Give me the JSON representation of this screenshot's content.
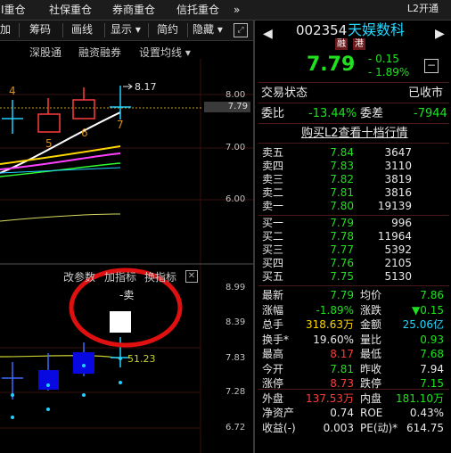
{
  "top_tabs": [
    "I重仓",
    "社保重仓",
    "券商重仓",
    "信托重仓",
    "»"
  ],
  "l2_label": "L2开通",
  "toolbar": [
    "加",
    "筹码",
    "画线",
    "显示 ▾",
    "简约",
    "隐藏 ▾"
  ],
  "subtoolbar": [
    "深股通",
    "融资融券",
    "设置均线 ▾"
  ],
  "candle_labels": [
    "4",
    "5",
    "6",
    "7"
  ],
  "high_marker": "8.17",
  "price_axis": [
    "8.00",
    "7.00",
    "6.00"
  ],
  "current_price_tag": "7.79",
  "indicator_toolbar": [
    "改参数",
    "加指标",
    "换指标"
  ],
  "sell_signal": "-卖",
  "indicator_value": "51.23",
  "indicator_axis": [
    "8.99",
    "8.39",
    "7.83",
    "7.28",
    "6.72"
  ],
  "stock": {
    "code": "002354",
    "name": "天娱数科",
    "badges": [
      "融",
      "港"
    ],
    "price": "7.79",
    "change": "- 0.15",
    "change_pct": "- 1.89%",
    "minus_btn": "−",
    "prev_arrow": "◀",
    "next_arrow": "▶"
  },
  "status": {
    "label": "交易状态",
    "value": "已收市"
  },
  "ratio": {
    "label1": "委比",
    "value1": "-13.44%",
    "label2": "委差",
    "value2": "-7944"
  },
  "buy_l2_link": "购买L2查看十档行情",
  "asks": [
    {
      "label": "卖五",
      "price": "7.84",
      "vol": "3647"
    },
    {
      "label": "卖四",
      "price": "7.83",
      "vol": "3110"
    },
    {
      "label": "卖三",
      "price": "7.82",
      "vol": "3819"
    },
    {
      "label": "卖二",
      "price": "7.81",
      "vol": "3816"
    },
    {
      "label": "卖一",
      "price": "7.80",
      "vol": "19139"
    }
  ],
  "bids": [
    {
      "label": "买一",
      "price": "7.79",
      "vol": "996"
    },
    {
      "label": "买二",
      "price": "7.78",
      "vol": "11964"
    },
    {
      "label": "买三",
      "price": "7.77",
      "vol": "5392"
    },
    {
      "label": "买四",
      "price": "7.76",
      "vol": "2105"
    },
    {
      "label": "买五",
      "price": "7.75",
      "vol": "5130"
    }
  ],
  "stats": [
    {
      "l1": "最新",
      "v1": "7.79",
      "c1": "green",
      "l2": "均价",
      "v2": "7.86",
      "c2": "green"
    },
    {
      "l1": "涨幅",
      "v1": "-1.89%",
      "c1": "green",
      "l2": "涨跌",
      "v2": "▼0.15",
      "c2": "green"
    },
    {
      "l1": "总手",
      "v1": "318.63万",
      "c1": "yellow",
      "l2": "金额",
      "v2": "25.06亿",
      "c2": "cyan"
    },
    {
      "l1": "换手*",
      "v1": "19.60%",
      "c1": "white",
      "l2": "量比",
      "v2": "0.93",
      "c2": "green"
    },
    {
      "l1": "最高",
      "v1": "8.17",
      "c1": "red",
      "l2": "最低",
      "v2": "7.68",
      "c2": "green"
    },
    {
      "l1": "今开",
      "v1": "7.81",
      "c1": "green",
      "l2": "昨收",
      "v2": "7.94",
      "c2": "white"
    },
    {
      "l1": "涨停",
      "v1": "8.73",
      "c1": "red",
      "l2": "跌停",
      "v2": "7.15",
      "c2": "green"
    },
    {
      "l1": "外盘",
      "v1": "137.53万",
      "c1": "red",
      "l2": "内盘",
      "v2": "181.10万",
      "c2": "green"
    },
    {
      "l1": "净资产",
      "v1": "0.74",
      "c1": "white",
      "l2": "ROE",
      "v2": "0.43%",
      "c2": "white"
    },
    {
      "l1": "收益(-)",
      "v1": "0.003",
      "c1": "white",
      "l2": "PE(动)*",
      "v2": "614.75",
      "c2": "white"
    }
  ],
  "colors": {
    "up": "#ff3c3c",
    "down": "#20e020",
    "ma_white": "#ffffff",
    "ma_yellow": "#ffd700",
    "ma_magenta": "#ff40ff",
    "ma_green": "#30ff30",
    "ma_cyan": "#20d0ff",
    "annotation_circle": "#e01010"
  }
}
